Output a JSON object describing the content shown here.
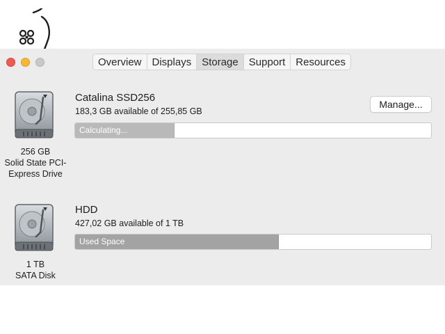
{
  "window": {
    "traffic_lights": [
      "close",
      "minimize",
      "zoom"
    ],
    "colors": {
      "close": "#ee5a52",
      "minimize": "#f5b73a",
      "zoom": "#c9c9c9"
    }
  },
  "tabs": [
    {
      "label": "Overview",
      "active": false
    },
    {
      "label": "Displays",
      "active": false
    },
    {
      "label": "Storage",
      "active": true
    },
    {
      "label": "Support",
      "active": false
    },
    {
      "label": "Resources",
      "active": false
    }
  ],
  "drives": [
    {
      "icon": "hard-drive-icon",
      "name": "Catalina SSD256",
      "available": "183,3 GB available of 255,85 GB",
      "desc": [
        "256 GB",
        "Solid State PCI-",
        "Express Drive"
      ],
      "bar_label": "Calculating...",
      "bar_fill_fraction": 0.28,
      "manage_label": "Manage..."
    },
    {
      "icon": "hard-drive-icon",
      "name": "HDD",
      "available": "427,02 GB available of 1 TB",
      "desc": [
        "1 TB",
        "SATA Disk"
      ],
      "bar_label": "Used Space",
      "bar_fill_fraction": 0.573
    }
  ]
}
